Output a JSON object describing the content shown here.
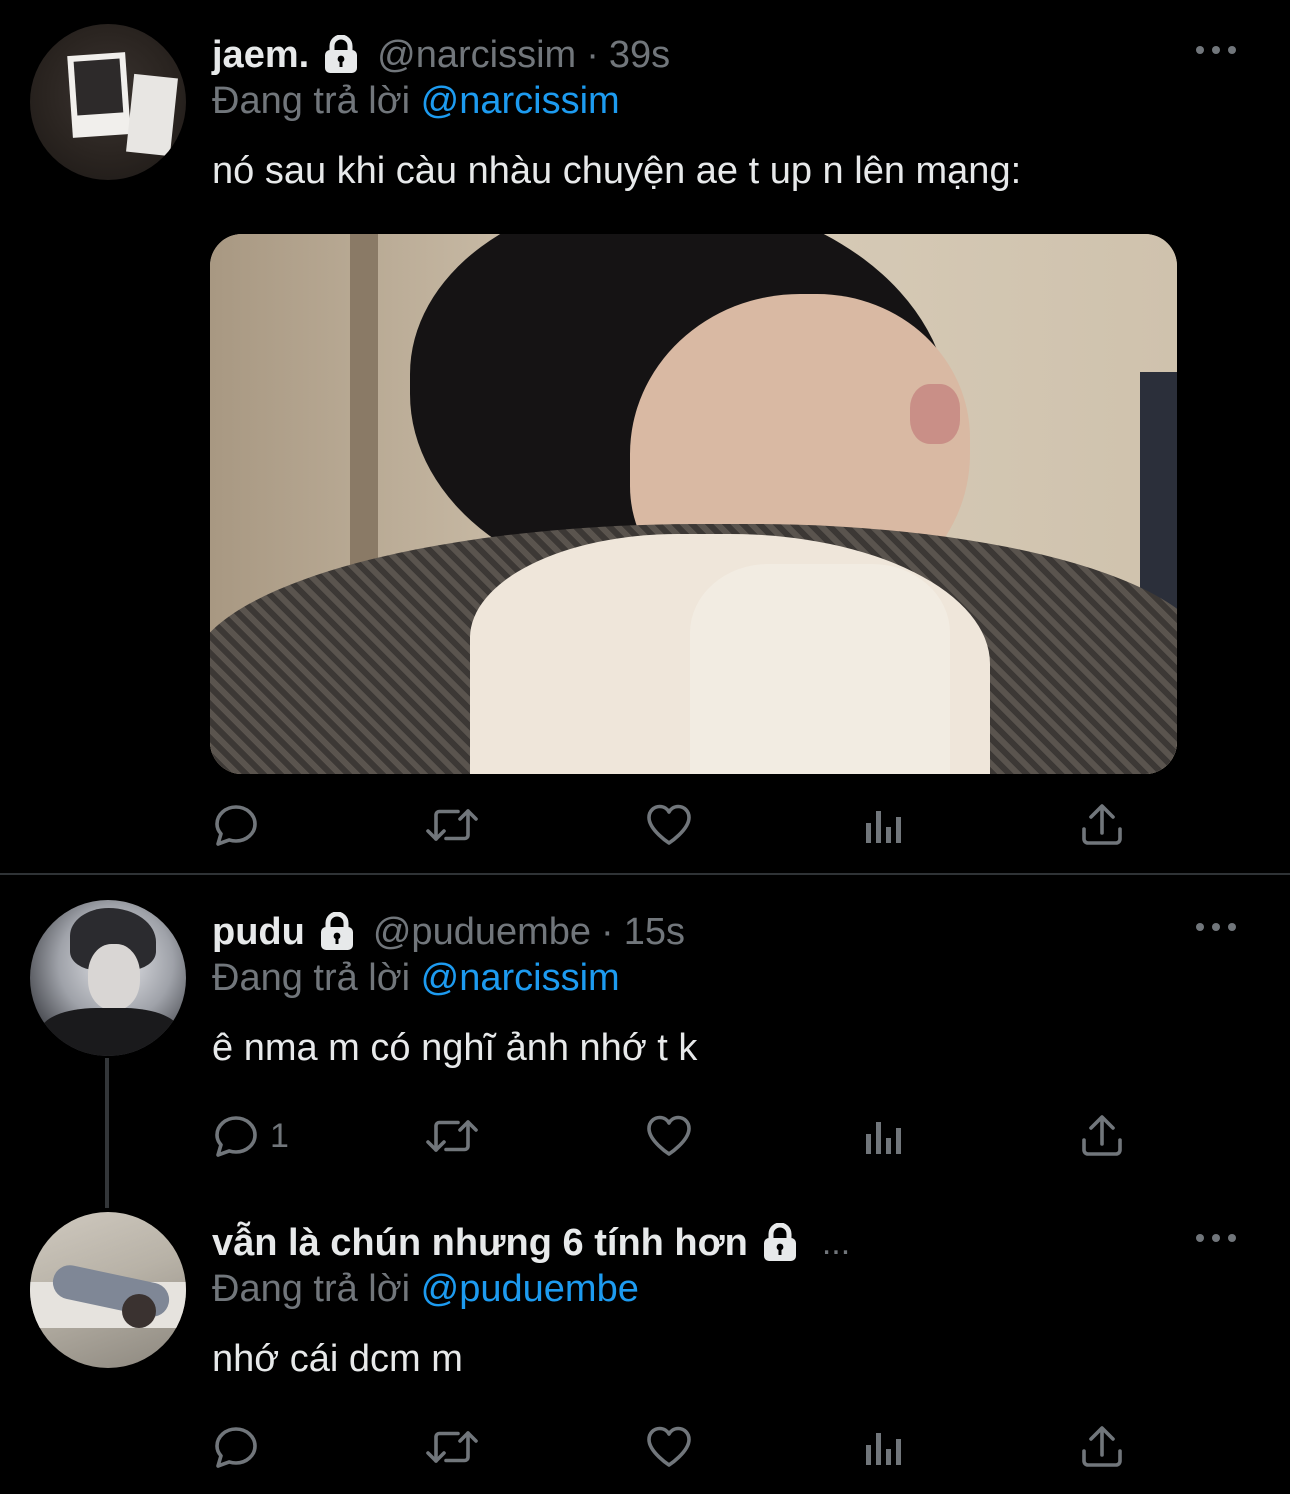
{
  "tweets": [
    {
      "name": "jaem.",
      "handle": "@narcissim",
      "sep": "·",
      "time": "39s",
      "replying_prefix": "Đang trả lời",
      "replying_to": "@narcissim",
      "text": "nó sau khi càu nhàu chuyện ae t up n lên mạng:",
      "has_media": true,
      "reply_count": ""
    },
    {
      "name": "pudu",
      "handle": "@puduembe",
      "sep": "·",
      "time": "15s",
      "replying_prefix": "Đang trả lời",
      "replying_to": "@narcissim",
      "text": "ê nma m có nghĩ ảnh nhớ t k",
      "has_media": false,
      "reply_count": "1"
    },
    {
      "name": "vẫn là chún nhưng 6 tính hơn",
      "truncation": "...",
      "replying_prefix": "Đang trả lời",
      "replying_to": "@puduembe",
      "text": "nhớ cái dcm m",
      "has_media": false,
      "reply_count": ""
    }
  ],
  "icons": {
    "lock": "lock-icon",
    "more": "more-icon",
    "reply": "reply-icon",
    "retweet": "retweet-icon",
    "like": "heart-icon",
    "stats": "analytics-icon",
    "share": "share-icon"
  },
  "colors": {
    "background": "#000000",
    "text": "#e7e9ea",
    "secondary": "#71767b",
    "accent": "#1d9bf0",
    "divider": "#2f3336"
  }
}
